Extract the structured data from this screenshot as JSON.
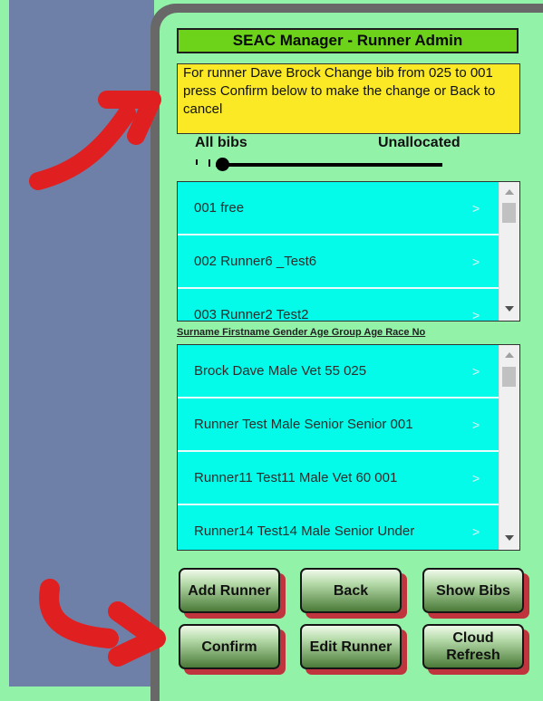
{
  "title": "SEAC Manager - Runner Admin",
  "message": "For runner Dave  Brock  Change bib from 025 to 001  press Confirm below to  make the change or Back to cancel",
  "slider": {
    "left_label": "All bibs",
    "right_label": "Unallocated",
    "value": 0
  },
  "bib_list": [
    {
      "label": "001  free"
    },
    {
      "label": "002  Runner6 _Test6"
    },
    {
      "label": "003  Runner2  Test2"
    }
  ],
  "runner_header": "Surname Firstname Gender Age Group Age Race No",
  "runner_list": [
    {
      "label": "Brock Dave Male Vet 55 025"
    },
    {
      "label": "Runner Test Male Senior Senior 001"
    },
    {
      "label": "Runner11 Test11 Male Vet 60 001"
    },
    {
      "label": "Runner14 Test14 Male Senior Under"
    }
  ],
  "buttons": {
    "add_runner": "Add Runner",
    "back": "Back",
    "show_bibs": "Show Bibs",
    "confirm": "Confirm",
    "edit_runner": "Edit Runner",
    "cloud_refresh": "Cloud Refresh"
  },
  "icons": {
    "chevron": "chevron-right-icon",
    "scroll_up": "scroll-up-icon",
    "scroll_down": "scroll-down-icon"
  },
  "colors": {
    "background": "#92F2A8",
    "title_bar": "#6CD21A",
    "message_box": "#FAE924",
    "list_item": "#04FBE9",
    "button_shadow": "#C0353D",
    "annotation_arrow": "#E02020"
  }
}
